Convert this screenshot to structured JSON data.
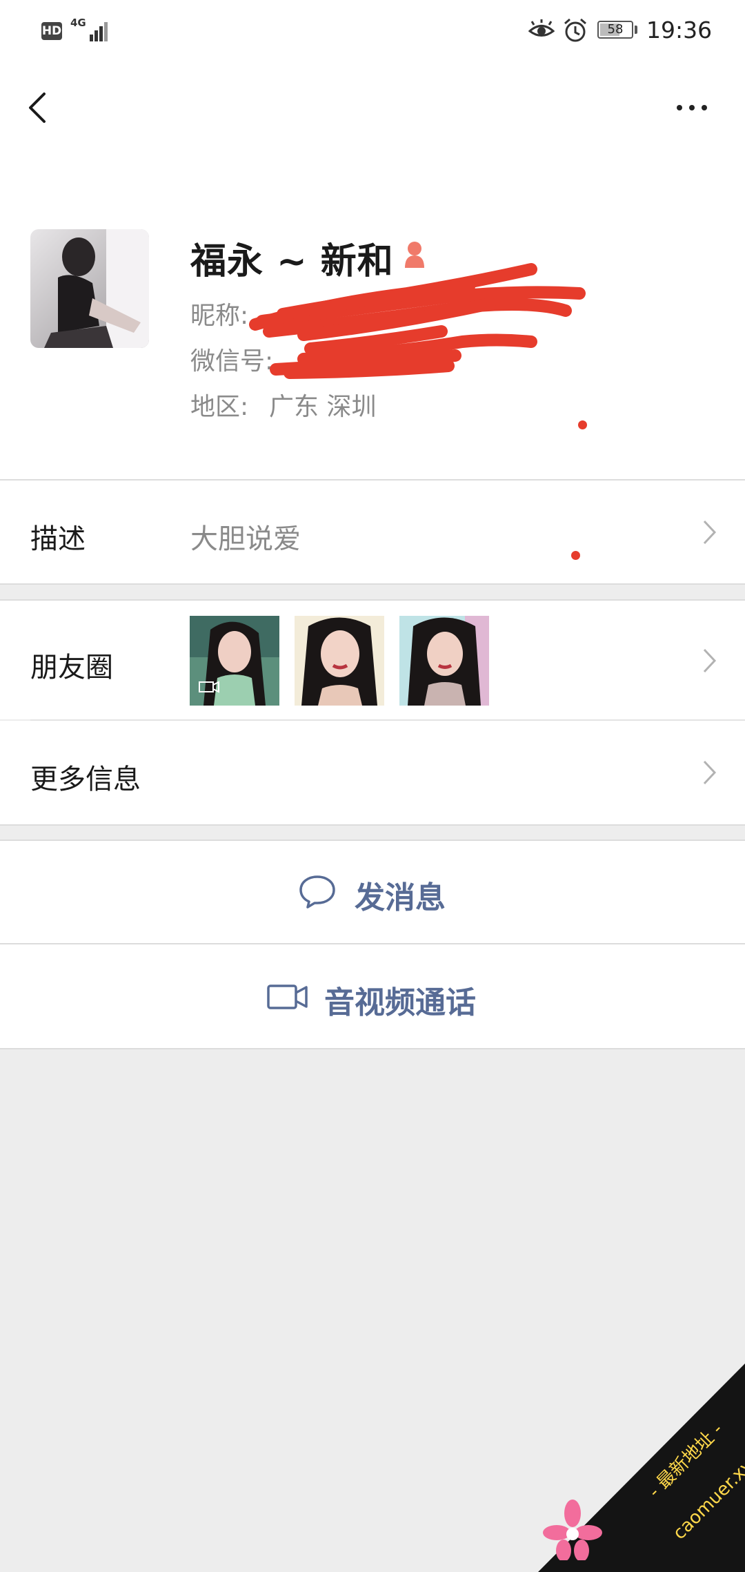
{
  "status_bar": {
    "hd": "HD",
    "network": "4G",
    "battery": "58",
    "time": "19:36"
  },
  "header": {
    "back_icon": "chevron-left-icon",
    "more_icon": "ellipsis-icon"
  },
  "profile": {
    "name": "福永 ~ 新和",
    "nickname_label": "昵称:",
    "wechat_id_label": "微信号:",
    "region_label": "地区:",
    "region_value": "广东  深圳",
    "gender_icon": "female-icon"
  },
  "cells": {
    "description": {
      "label": "描述",
      "value": "大胆说爱"
    },
    "moments": {
      "label": "朋友圈"
    },
    "more_info": {
      "label": "更多信息"
    }
  },
  "actions": {
    "send_message": "发消息",
    "video_call": "音视频通话"
  },
  "watermark": {
    "line1": "- 最新地址 -",
    "line2": "caomuer.xyz"
  },
  "colors": {
    "link_blue": "#576b95",
    "background": "#ededed",
    "scribble_red": "#e63c2c"
  }
}
